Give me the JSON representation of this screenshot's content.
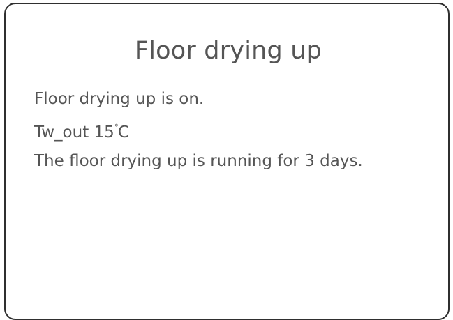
{
  "title": "Floor drying up",
  "status_line": "Floor drying up is on.",
  "tw_out": {
    "label": "Tw_out",
    "value": "15",
    "degree_symbol": "°",
    "unit": "C"
  },
  "running_line": "The floor drying up is running for 3 days."
}
